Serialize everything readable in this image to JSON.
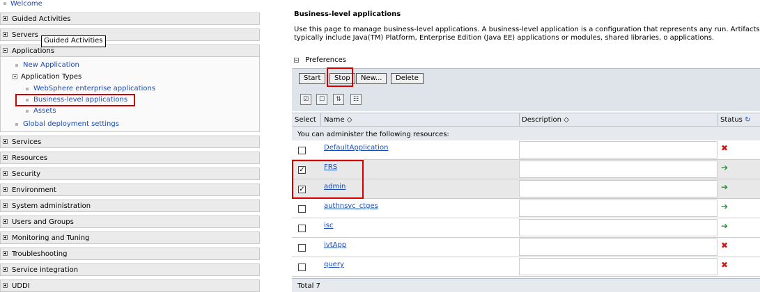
{
  "nav": {
    "welcome": "Welcome",
    "sections": [
      {
        "label": "Guided Activities",
        "expanded": false
      },
      {
        "label": "Servers",
        "expanded": false
      },
      {
        "label": "Applications",
        "expanded": true
      },
      {
        "label": "Services",
        "expanded": false
      },
      {
        "label": "Resources",
        "expanded": false
      },
      {
        "label": "Security",
        "expanded": false
      },
      {
        "label": "Environment",
        "expanded": false
      },
      {
        "label": "System administration",
        "expanded": false
      },
      {
        "label": "Users and Groups",
        "expanded": false
      },
      {
        "label": "Monitoring and Tuning",
        "expanded": false
      },
      {
        "label": "Troubleshooting",
        "expanded": false
      },
      {
        "label": "Service integration",
        "expanded": false
      },
      {
        "label": "UDDI",
        "expanded": false
      }
    ],
    "applications": {
      "new_application": "New Application",
      "application_types": "Application Types",
      "websphere_apps": "WebSphere enterprise applications",
      "business_level_apps": "Business-level applications",
      "assets": "Assets",
      "global_deployment": "Global deployment settings"
    },
    "tooltip": "Guided Activities"
  },
  "main": {
    "title": "Business-level applications",
    "description": "Use this page to manage business-level applications. A business-level application is a configuration that represents any run. Artifacts typically include Java(TM) Platform, Enterprise Edition (Java EE) applications or modules, shared libraries, o applications.",
    "preferences": "Preferences",
    "buttons": {
      "start": "Start",
      "stop": "Stop",
      "new": "New...",
      "delete": "Delete"
    },
    "columns": {
      "select": "Select",
      "name": "Name",
      "description": "Description",
      "status": "Status"
    },
    "admin_text": "You can administer the following resources:",
    "rows": [
      {
        "name": "DefaultApplication",
        "checked": false,
        "status": "stopped"
      },
      {
        "name": "FRS",
        "checked": true,
        "status": "started"
      },
      {
        "name": "admin",
        "checked": true,
        "status": "started"
      },
      {
        "name": "authnsvc_ctges",
        "checked": false,
        "status": "started"
      },
      {
        "name": "isc",
        "checked": false,
        "status": "started"
      },
      {
        "name": "ivtApp",
        "checked": false,
        "status": "stopped"
      },
      {
        "name": "query",
        "checked": false,
        "status": "stopped"
      }
    ],
    "total": "Total 7"
  },
  "colors": {
    "highlight": "#d40000",
    "link": "#1a4bb5",
    "started": "#1d9a3a",
    "stopped": "#d21a1a"
  }
}
